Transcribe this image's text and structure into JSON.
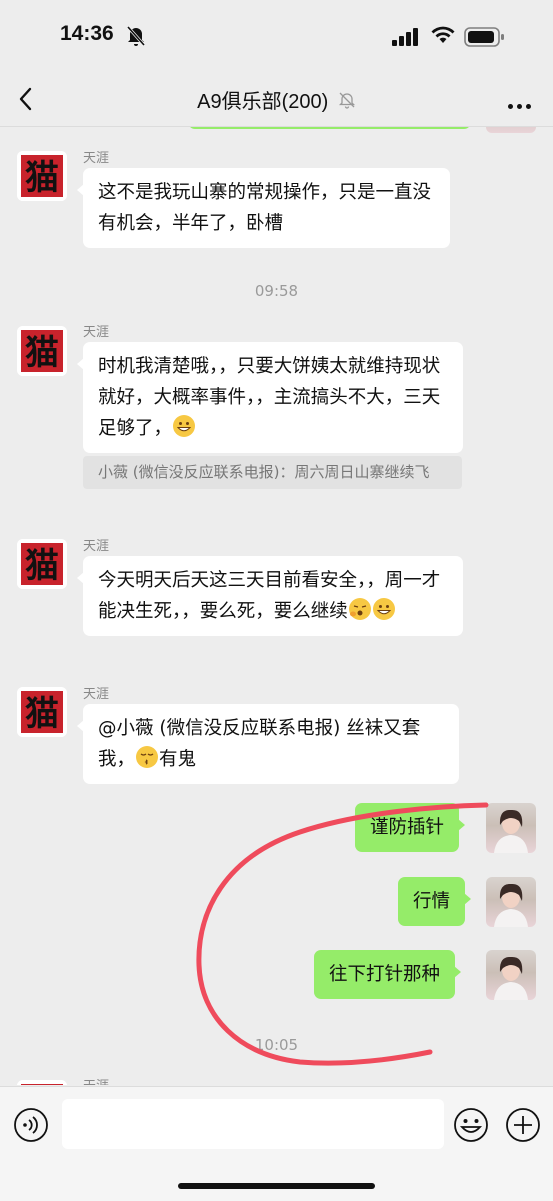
{
  "status_bar": {
    "time": "14:36"
  },
  "header": {
    "title": "A9俱乐部(200)",
    "back_icon": "chevron-left-icon",
    "more_icon": "more-dots-icon",
    "mute_icon": "bell-slash-icon"
  },
  "messages": [
    {
      "sender": "天涯",
      "text": "这不是我玩山寨的常规操作，只是一直没有机会，半年了，卧槽"
    },
    {
      "timestamp": "09:58"
    },
    {
      "sender": "天涯",
      "text": "时机我清楚哦，，只要大饼姨太就维持现状就好，大概率事件，，主流搞头不大，三天足够了，",
      "quote": "小薇 (微信没反应联系电报)：周六周日山寨继续飞"
    },
    {
      "sender": "天涯",
      "text": "今天明天后天这三天目前看安全，，周一才能决生死，，要么死，要么继续"
    },
    {
      "sender": "天涯",
      "text": "@小薇 (微信没反应联系电报) 丝袜又套我，",
      "text_tail": "有鬼"
    },
    {
      "self": true,
      "text": "谨防插针"
    },
    {
      "self": true,
      "text": "行情"
    },
    {
      "self": true,
      "text": "往下打针那种"
    },
    {
      "timestamp": "10:05"
    },
    {
      "sender": "天涯"
    }
  ],
  "input_bar": {
    "voice_icon": "voice-icon",
    "emoji_icon": "emoji-icon",
    "plus_icon": "plus-circle-icon",
    "placeholder": ""
  },
  "colors": {
    "self_bubble": "#95ec69",
    "background": "#ededed",
    "annotation": "#ef4b5c"
  }
}
